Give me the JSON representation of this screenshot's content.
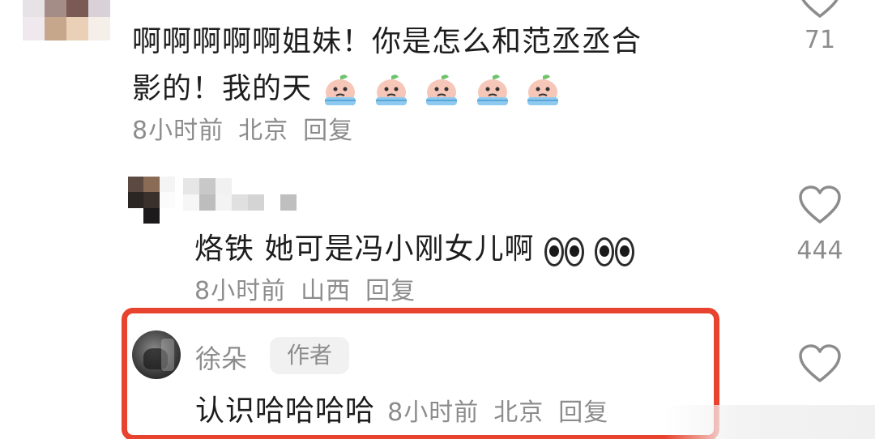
{
  "comments": [
    {
      "text_line1": "啊啊啊啊啊姐妹！你是怎么和范丞丞合",
      "text_line2": "影的！我的天",
      "emoji_icon": "crying-peach-emoji",
      "emoji_count": 5,
      "time": "8小时前",
      "location": "北京",
      "reply_label": "回复",
      "like_count": "71"
    },
    {
      "text": "烙铁 她可是冯小刚女儿啊",
      "emoji_icon": "eyes-emoji",
      "time": "8小时前",
      "location": "山西",
      "reply_label": "回复",
      "like_count": "444"
    },
    {
      "author_name": "徐朵",
      "author_badge": "作者",
      "text": "认识哈哈哈哈",
      "time": "8小时前",
      "location": "北京",
      "reply_label": "回复"
    }
  ],
  "colors": {
    "text": "#1d1d1d",
    "meta": "#8c8c8c",
    "highlight_border": "#e8432e",
    "badge_bg": "#f1f1f1"
  },
  "icons": {
    "like": "heart-outline-icon"
  }
}
